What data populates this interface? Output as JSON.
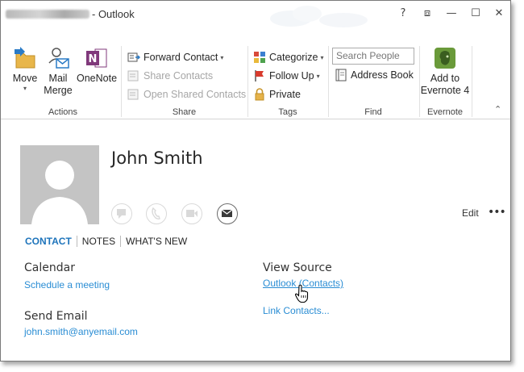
{
  "window": {
    "title": "- Outlook"
  },
  "titlebar": {
    "help": "?",
    "restore_ribbon": "⧈",
    "minimize": "—",
    "maximize": "☐",
    "close": "✕"
  },
  "ribbon": {
    "actions": {
      "label": "Actions",
      "move": "Move",
      "mail_merge_line1": "Mail",
      "mail_merge_line2": "Merge",
      "onenote": "OneNote"
    },
    "share": {
      "label": "Share",
      "forward_contact": "Forward Contact",
      "share_contacts": "Share Contacts",
      "open_shared_contacts": "Open Shared Contacts"
    },
    "tags": {
      "label": "Tags",
      "categorize": "Categorize",
      "follow_up": "Follow Up",
      "private": "Private"
    },
    "find": {
      "label": "Find",
      "search_placeholder": "Search People",
      "address_book": "Address Book"
    },
    "evernote": {
      "label": "Evernote",
      "add_line1": "Add to",
      "add_line2": "Evernote 4"
    }
  },
  "contact": {
    "name": "John Smith",
    "edit": "Edit",
    "more": "•••",
    "tabs": [
      "CONTACT",
      "NOTES",
      "WHAT'S NEW"
    ],
    "calendar_title": "Calendar",
    "schedule_meeting": "Schedule a meeting",
    "send_email_title": "Send Email",
    "email": "john.smith@anyemail.com",
    "view_source_title": "View Source",
    "source_link": "Outlook (Contacts)",
    "link_contacts": "Link Contacts..."
  },
  "colors": {
    "accent": "#1e74bb",
    "link": "#2a8dd4",
    "onenote": "#80397b",
    "evernote": "#6a9a3a"
  }
}
